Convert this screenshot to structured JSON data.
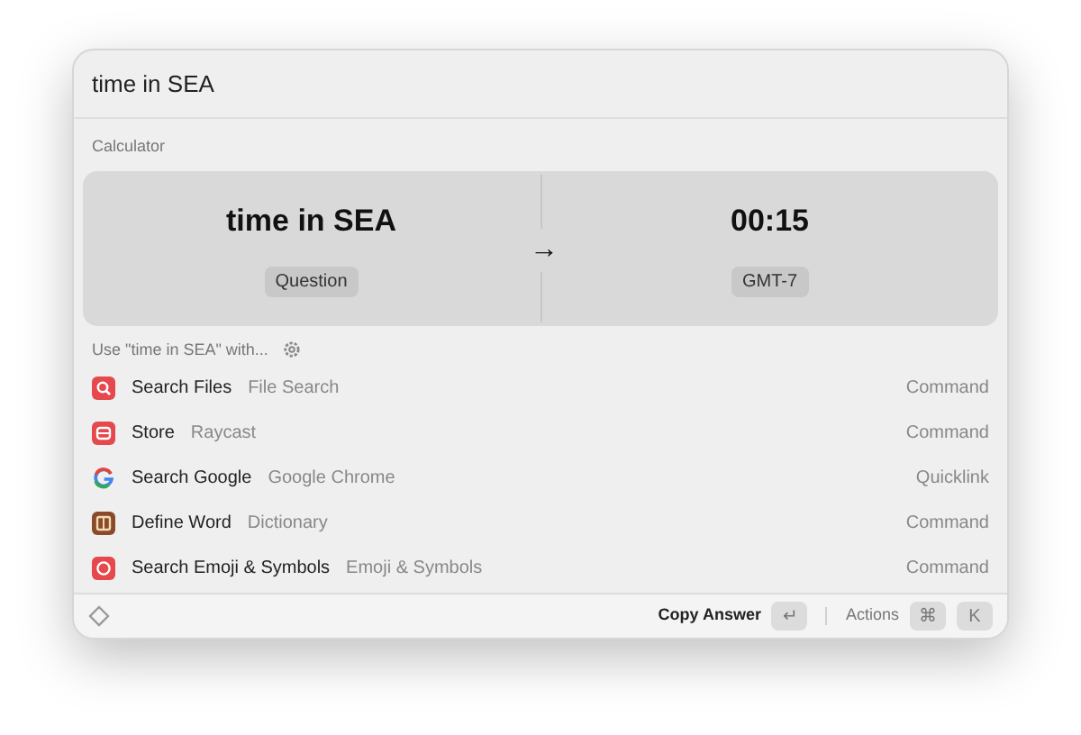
{
  "search": {
    "value": "time in SEA"
  },
  "section_title": "Calculator",
  "calculator": {
    "question": "time in SEA",
    "question_tag": "Question",
    "arrow": "→",
    "answer": "00:15",
    "answer_tag": "GMT-7"
  },
  "use_with": {
    "label": "Use \"time in SEA\" with..."
  },
  "items": [
    {
      "kind": "files",
      "title": "Search Files",
      "subtitle": "File Search",
      "type": "Command"
    },
    {
      "kind": "store",
      "title": "Store",
      "subtitle": "Raycast",
      "type": "Command"
    },
    {
      "kind": "google",
      "title": "Search Google",
      "subtitle": "Google Chrome",
      "type": "Quicklink"
    },
    {
      "kind": "dictionary",
      "title": "Define Word",
      "subtitle": "Dictionary",
      "type": "Command"
    },
    {
      "kind": "emoji",
      "title": "Search Emoji & Symbols",
      "subtitle": "Emoji & Symbols",
      "type": "Command"
    }
  ],
  "footer": {
    "primary_action": "Copy Answer",
    "primary_keys": [
      "↵"
    ],
    "actions_label": "Actions",
    "actions_keys": [
      "⌘",
      "K"
    ]
  }
}
